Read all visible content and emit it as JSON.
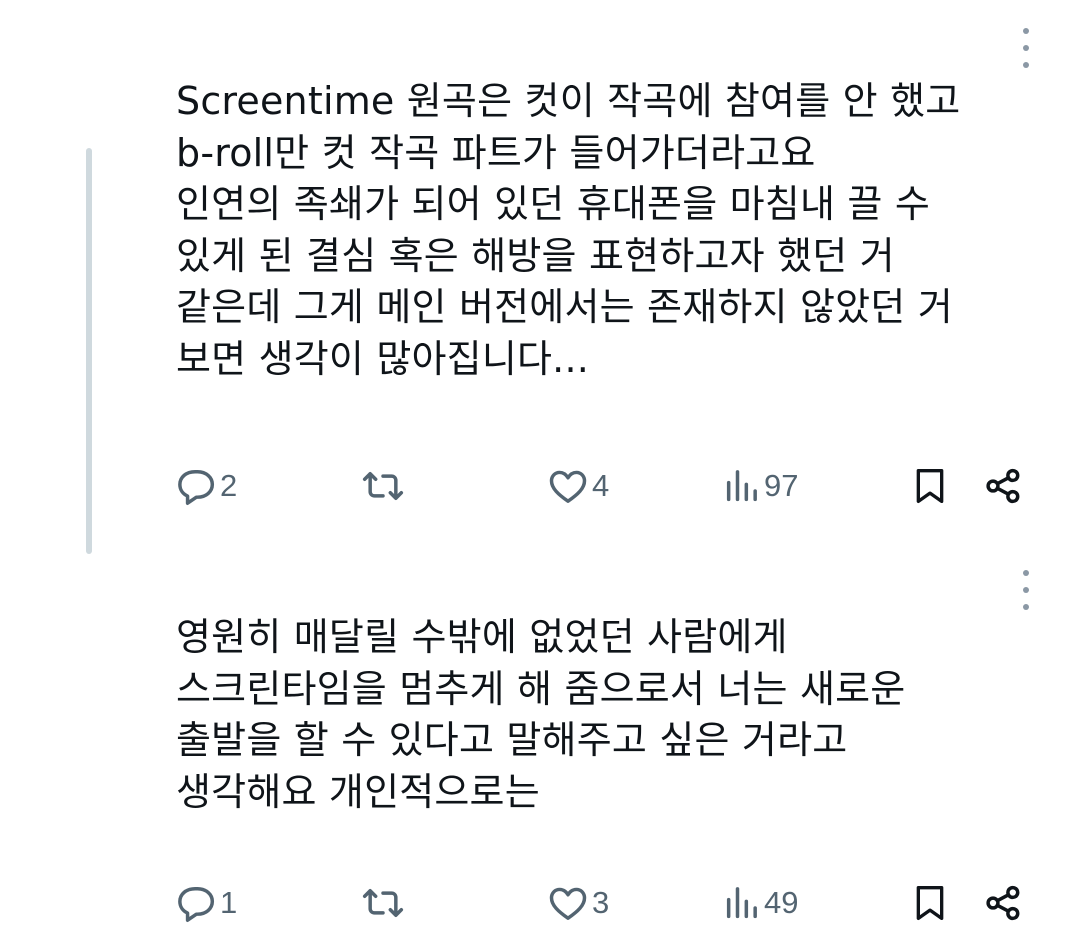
{
  "colors": {
    "text": "#0f1419",
    "icon": "#536471",
    "thread_line": "#cfd9de",
    "more_dots": "#8b98a5"
  },
  "posts": [
    {
      "text": "Screentime 원곡은 컷이 작곡에 참여를 안 했고\nb-roll만 컷 작곡 파트가 들어가더라고요\n인연의 족쇄가 되어 있던 휴대폰을 마침내 끌 수\n있게 된 결심 혹은 해방을 표현하고자 했던 거\n같은데 그게 메인 버전에서는 존재하지 않았던 거\n보면 생각이 많아집니다...",
      "replies": "2",
      "likes": "4",
      "views": "97",
      "icons": [
        "more-icon",
        "reply-icon",
        "repost-icon",
        "like-icon",
        "views-icon",
        "bookmark-icon",
        "share-icon"
      ]
    },
    {
      "text": "영원히 매달릴 수밖에 없었던 사람에게\n스크린타임을 멈추게 해 줌으로서 너는 새로운\n출발을 할 수 있다고 말해주고 싶은 거라고\n생각해요 개인적으로는",
      "replies": "1",
      "likes": "3",
      "views": "49",
      "icons": [
        "more-icon",
        "reply-icon",
        "repost-icon",
        "like-icon",
        "views-icon",
        "bookmark-icon",
        "share-icon"
      ]
    }
  ]
}
